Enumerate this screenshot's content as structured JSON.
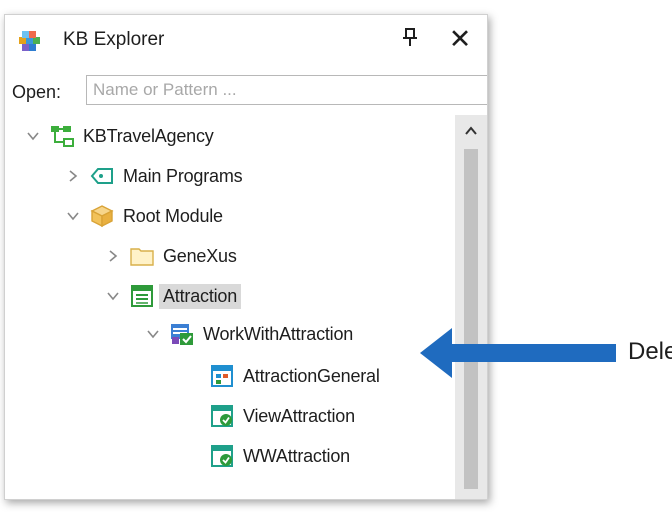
{
  "panel": {
    "title": "KB Explorer",
    "pin_icon": "pin-icon",
    "close_glyph": "✕"
  },
  "open": {
    "label": "Open:",
    "placeholder": "Name or Pattern ..."
  },
  "tree": [
    {
      "label": "KBTravelAgency",
      "icon": "kb-root-icon",
      "expanded": true
    },
    {
      "label": "Main Programs",
      "icon": "main-programs-icon",
      "expanded": false
    },
    {
      "label": "Root Module",
      "icon": "module-icon",
      "expanded": true
    },
    {
      "label": "GeneXus",
      "icon": "folder-icon",
      "expanded": false
    },
    {
      "label": "Attraction",
      "icon": "transaction-icon",
      "expanded": true,
      "selected": true
    },
    {
      "label": "WorkWithAttraction",
      "icon": "work-with-icon",
      "expanded": true
    },
    {
      "label": "AttractionGeneral",
      "icon": "web-component-icon"
    },
    {
      "label": "ViewAttraction",
      "icon": "web-panel-icon"
    },
    {
      "label": "WWAttraction",
      "icon": "web-panel-icon"
    }
  ],
  "annotation": {
    "text": "Delete",
    "arrow_color": "#1f6bbf"
  }
}
